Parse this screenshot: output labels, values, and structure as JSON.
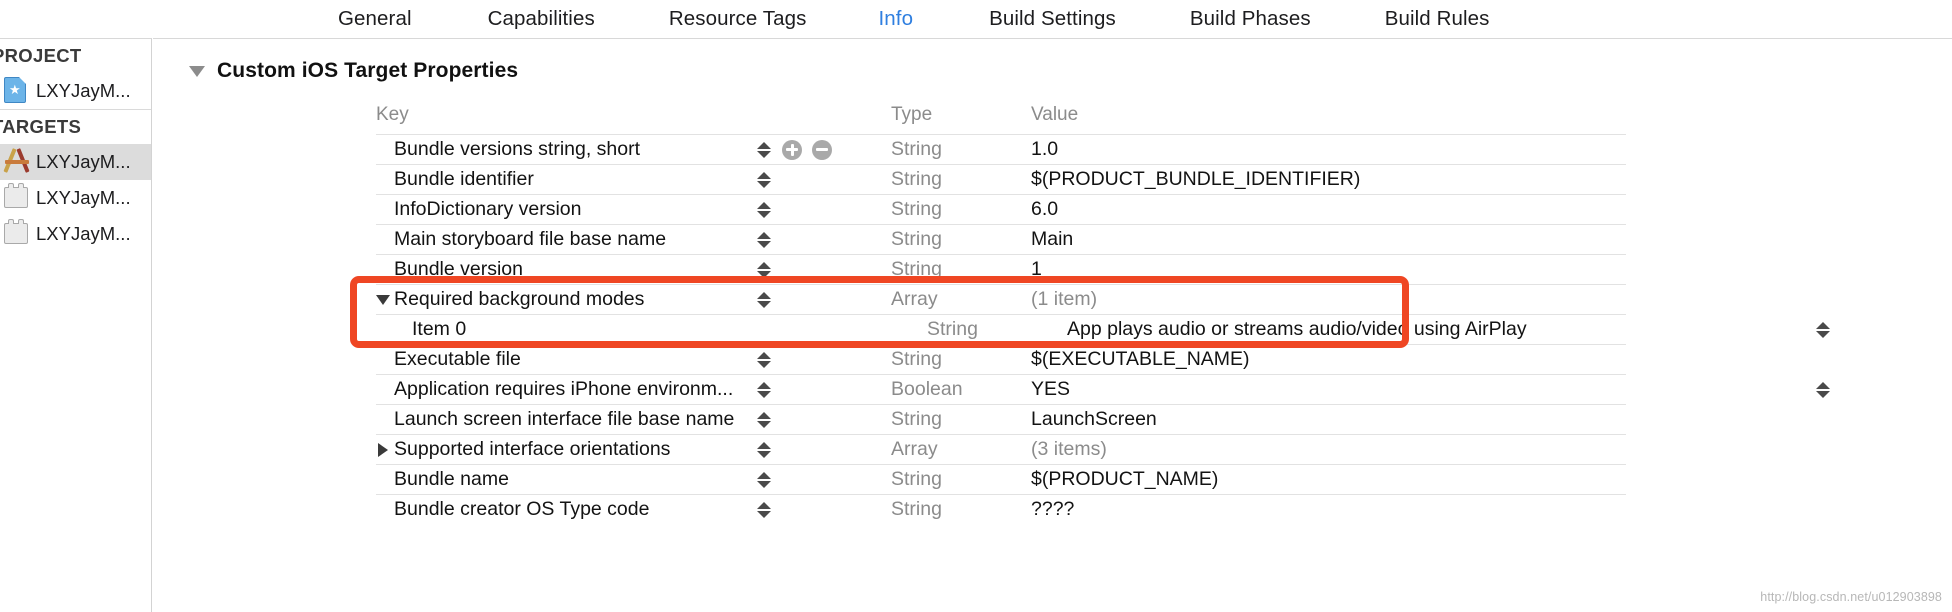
{
  "tabs": [
    {
      "label": "General",
      "active": false
    },
    {
      "label": "Capabilities",
      "active": false
    },
    {
      "label": "Resource Tags",
      "active": false
    },
    {
      "label": "Info",
      "active": true
    },
    {
      "label": "Build Settings",
      "active": false
    },
    {
      "label": "Build Phases",
      "active": false
    },
    {
      "label": "Build Rules",
      "active": false
    }
  ],
  "sidebar": {
    "project_header": "PROJECT",
    "targets_header": "TARGETS",
    "project_items": [
      {
        "label": "LXYJayM...",
        "icon": "project-document-icon"
      }
    ],
    "target_items": [
      {
        "label": "LXYJayM...",
        "icon": "app-target-icon",
        "selected": true
      },
      {
        "label": "LXYJayM...",
        "icon": "bundle-target-icon",
        "selected": false
      },
      {
        "label": "LXYJayM...",
        "icon": "bundle-target-icon",
        "selected": false
      }
    ]
  },
  "section": {
    "title": "Custom iOS Target Properties",
    "expanded": true
  },
  "table": {
    "headers": {
      "key": "Key",
      "type": "Type",
      "value": "Value"
    },
    "rows": [
      {
        "key": "Bundle versions string, short",
        "type": "String",
        "value": "1.0",
        "indent": 0,
        "disclosure": "none",
        "stepper": true,
        "add_remove": true,
        "value_muted": false,
        "right_stepper": false
      },
      {
        "key": "Bundle identifier",
        "type": "String",
        "value": "$(PRODUCT_BUNDLE_IDENTIFIER)",
        "indent": 0,
        "disclosure": "none",
        "stepper": true,
        "add_remove": false,
        "value_muted": false,
        "right_stepper": false
      },
      {
        "key": "InfoDictionary version",
        "type": "String",
        "value": "6.0",
        "indent": 0,
        "disclosure": "none",
        "stepper": true,
        "add_remove": false,
        "value_muted": false,
        "right_stepper": false
      },
      {
        "key": "Main storyboard file base name",
        "type": "String",
        "value": "Main",
        "indent": 0,
        "disclosure": "none",
        "stepper": true,
        "add_remove": false,
        "value_muted": false,
        "right_stepper": false
      },
      {
        "key": "Bundle version",
        "type": "String",
        "value": "1",
        "indent": 0,
        "disclosure": "none",
        "stepper": true,
        "add_remove": false,
        "value_muted": false,
        "right_stepper": false
      },
      {
        "key": "Required background modes",
        "type": "Array",
        "value": "(1 item)",
        "indent": 0,
        "disclosure": "open",
        "stepper": true,
        "add_remove": false,
        "value_muted": true,
        "right_stepper": false
      },
      {
        "key": "Item 0",
        "type": "String",
        "value": "App plays audio or streams audio/video using AirPlay",
        "indent": 1,
        "disclosure": "none",
        "stepper": false,
        "add_remove": false,
        "value_muted": false,
        "right_stepper": true
      },
      {
        "key": "Executable file",
        "type": "String",
        "value": "$(EXECUTABLE_NAME)",
        "indent": 0,
        "disclosure": "none",
        "stepper": true,
        "add_remove": false,
        "value_muted": false,
        "right_stepper": false
      },
      {
        "key": "Application requires iPhone environm...",
        "type": "Boolean",
        "value": "YES",
        "indent": 0,
        "disclosure": "none",
        "stepper": true,
        "add_remove": false,
        "value_muted": false,
        "right_stepper": true
      },
      {
        "key": "Launch screen interface file base name",
        "type": "String",
        "value": "LaunchScreen",
        "indent": 0,
        "disclosure": "none",
        "stepper": true,
        "add_remove": false,
        "value_muted": false,
        "right_stepper": false
      },
      {
        "key": "Supported interface orientations",
        "type": "Array",
        "value": "(3 items)",
        "indent": 0,
        "disclosure": "closed",
        "stepper": true,
        "add_remove": false,
        "value_muted": true,
        "right_stepper": false
      },
      {
        "key": "Bundle name",
        "type": "String",
        "value": "$(PRODUCT_NAME)",
        "indent": 0,
        "disclosure": "none",
        "stepper": true,
        "add_remove": false,
        "value_muted": false,
        "right_stepper": false
      },
      {
        "key": "Bundle creator OS Type code",
        "type": "String",
        "value": "????",
        "indent": 0,
        "disclosure": "none",
        "stepper": true,
        "add_remove": false,
        "value_muted": false,
        "right_stepper": false
      }
    ]
  },
  "annotation": {
    "type": "red-highlight-rectangle",
    "color": "#ef4623",
    "highlights_rows": [
      "Required background modes",
      "Item 0"
    ]
  },
  "watermark": "http://blog.csdn.net/u012903898"
}
